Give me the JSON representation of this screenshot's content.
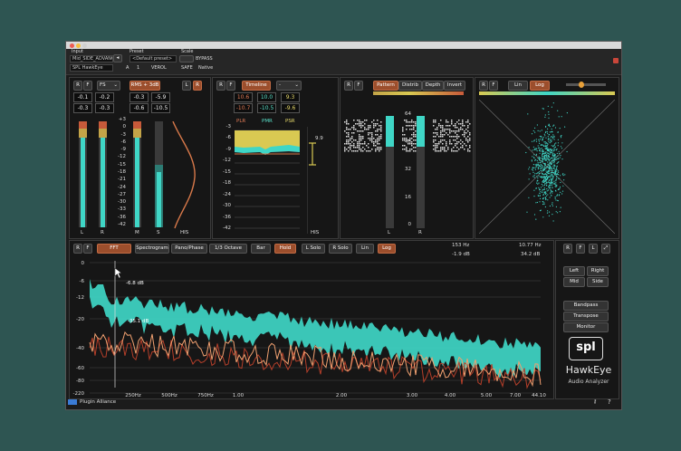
{
  "window": {
    "hdr_labels": [
      "Input",
      "Preset",
      "Scale"
    ],
    "input_value": "Mid_SIDE_ADVANCED",
    "mode_value": "SPL HawkEye",
    "preset_value": "<Default preset>",
    "scale_value": "1",
    "bypass_label": "BYPASS",
    "a_label": "A",
    "safe_label": "SAFE",
    "vu_label": "VEROL",
    "native_label": "Native"
  },
  "level_panel": {
    "r_label": "R",
    "f_label": "F",
    "fs_dropdown": "FS",
    "rms_button": "RMS + 3dB",
    "l_label": "L",
    "peak_values": [
      "-0.1",
      "-0.2",
      "-0.3",
      "-5.9"
    ],
    "rms_values": [
      "-0.3",
      "-0.3",
      "-0.6",
      "-10.5"
    ],
    "scale": [
      "+3",
      "0",
      "-3",
      "-6",
      "-9",
      "-12",
      "-15",
      "-18",
      "-21",
      "-24",
      "-27",
      "-30",
      "-33",
      "-36",
      "-42"
    ],
    "ch_labels": [
      "L",
      "R",
      "M",
      "S"
    ],
    "his_label": "HIS"
  },
  "timeline_panel": {
    "r_label": "R",
    "f_label": "F",
    "timeline_button": "Timeline",
    "dash_dropdown": "-",
    "row1": [
      "10.6",
      "10.0",
      "9.3"
    ],
    "row2": [
      "-10.7",
      "-10.5",
      "-9.6"
    ],
    "headers": [
      "PLR",
      "PMR",
      "PSR"
    ],
    "scale": [
      "-3",
      "-6",
      "-9",
      "-12",
      "-15",
      "-18",
      "-24",
      "-30",
      "-36",
      "-42"
    ],
    "marker": "9.9",
    "his_label": "HIS"
  },
  "pattern_panel": {
    "r_label": "R",
    "f_label": "F",
    "buttons": [
      "Pattern",
      "Distrib",
      "Depth",
      "Invert"
    ],
    "scale": [
      "64",
      "48",
      "32",
      "16",
      "0"
    ],
    "ch_labels": [
      "L",
      "R"
    ]
  },
  "vector_panel": {
    "r_label": "R",
    "f_label": "F",
    "lin_button": "Lin",
    "log_button": "Log"
  },
  "spectrum_panel": {
    "buttons": [
      "R",
      "F",
      "FFT",
      "Spectrogram",
      "Pano/Phase",
      "1/3 Octave",
      "Bar",
      "Hold",
      "L Solo",
      "R Solo",
      "Lin",
      "Log"
    ],
    "readout_freq1": "153 Hz",
    "readout_db1": "-1.9 dB",
    "readout_freq2": "10.77 Hz",
    "readout_db2": "34.2 dB",
    "peak_label": "-6.8 dB",
    "mid_label": "-35.1 dB",
    "y_scale": [
      "0",
      "-6",
      "-12",
      "-20",
      "-40",
      "-60",
      "-80",
      "-220"
    ],
    "x_scale": [
      "250Hz",
      "500Hz",
      "750Hz",
      "1.00",
      "2.00",
      "3.00",
      "4.00",
      "5.00",
      "7.00",
      "44.10"
    ]
  },
  "side_panel": {
    "top_buttons": [
      "R",
      "F",
      "L",
      "⤢"
    ],
    "channel_buttons": [
      "Left",
      "Right",
      "Mid",
      "Side"
    ],
    "mode_buttons": [
      "Bandpass",
      "Transpose",
      "Monitor"
    ],
    "brand_logo": "spl",
    "product_title": "HawkEye",
    "product_subtitle": "Audio Analyzer"
  },
  "footer": {
    "vendor": "Plugin Alliance",
    "help": "?"
  },
  "colors": {
    "accent": "#c26b44",
    "cyan": "#3fd6c6",
    "background": "#2e5552"
  }
}
